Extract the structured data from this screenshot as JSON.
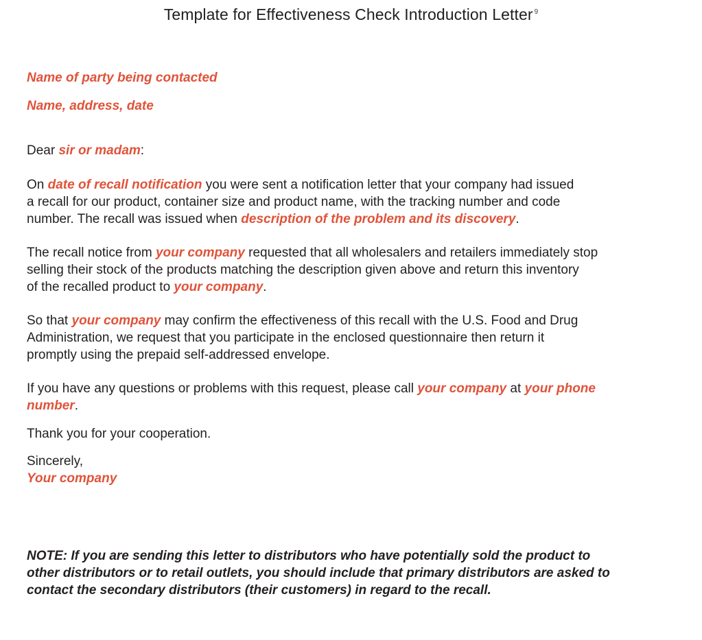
{
  "title": "Template for Effectiveness Check Introduction Letter",
  "title_footnote": "9",
  "colors": {
    "placeholder": "#e0533a",
    "text": "#231f20"
  },
  "header": {
    "party": "Name of party being contacted",
    "address": "Name, address, date"
  },
  "salutation": {
    "prefix": "Dear ",
    "placeholder": "sir or madam",
    "suffix": ":"
  },
  "p1": {
    "l1_a": "On ",
    "l1_ph": "date of recall notification",
    "l1_b": " you were sent a notification letter that your company had issued",
    "l2": "a recall for our product, container size and product name, with the tracking number and code",
    "l3_a": "number. The recall was issued when ",
    "l3_ph": "description of the problem and its discovery",
    "l3_b": "."
  },
  "p2": {
    "l1_a": "The recall notice from ",
    "l1_ph": "your company",
    "l1_b": " requested that all wholesalers and retailers immediately stop",
    "l2": "selling their stock of the products matching the description given above and return this inventory",
    "l3_a": "of the recalled product to ",
    "l3_ph": "your company",
    "l3_b": "."
  },
  "p3": {
    "l1_a": "So that ",
    "l1_ph": "your company",
    "l1_b": " may confirm the effectiveness of this recall with the U.S. Food and Drug",
    "l2": "Administration, we request that you participate in the enclosed questionnaire then return it",
    "l3": "promptly using the prepaid self-addressed envelope."
  },
  "p4": {
    "l1_a": "If you have any questions or problems with this request, please call ",
    "l1_ph1": "your company",
    "l1_b": " at ",
    "l1_ph2": "your phone",
    "l2_ph": "number",
    "l2_b": "."
  },
  "thanks": "Thank you for your cooperation.",
  "closing": "Sincerely,",
  "signature": "Your company",
  "note": {
    "l1": "NOTE: If you are sending this letter to distributors who have potentially sold the product to",
    "l2": "other distributors or to retail outlets, you should include that primary distributors are asked to",
    "l3": "contact the secondary distributors (their customers) in regard to the recall."
  }
}
